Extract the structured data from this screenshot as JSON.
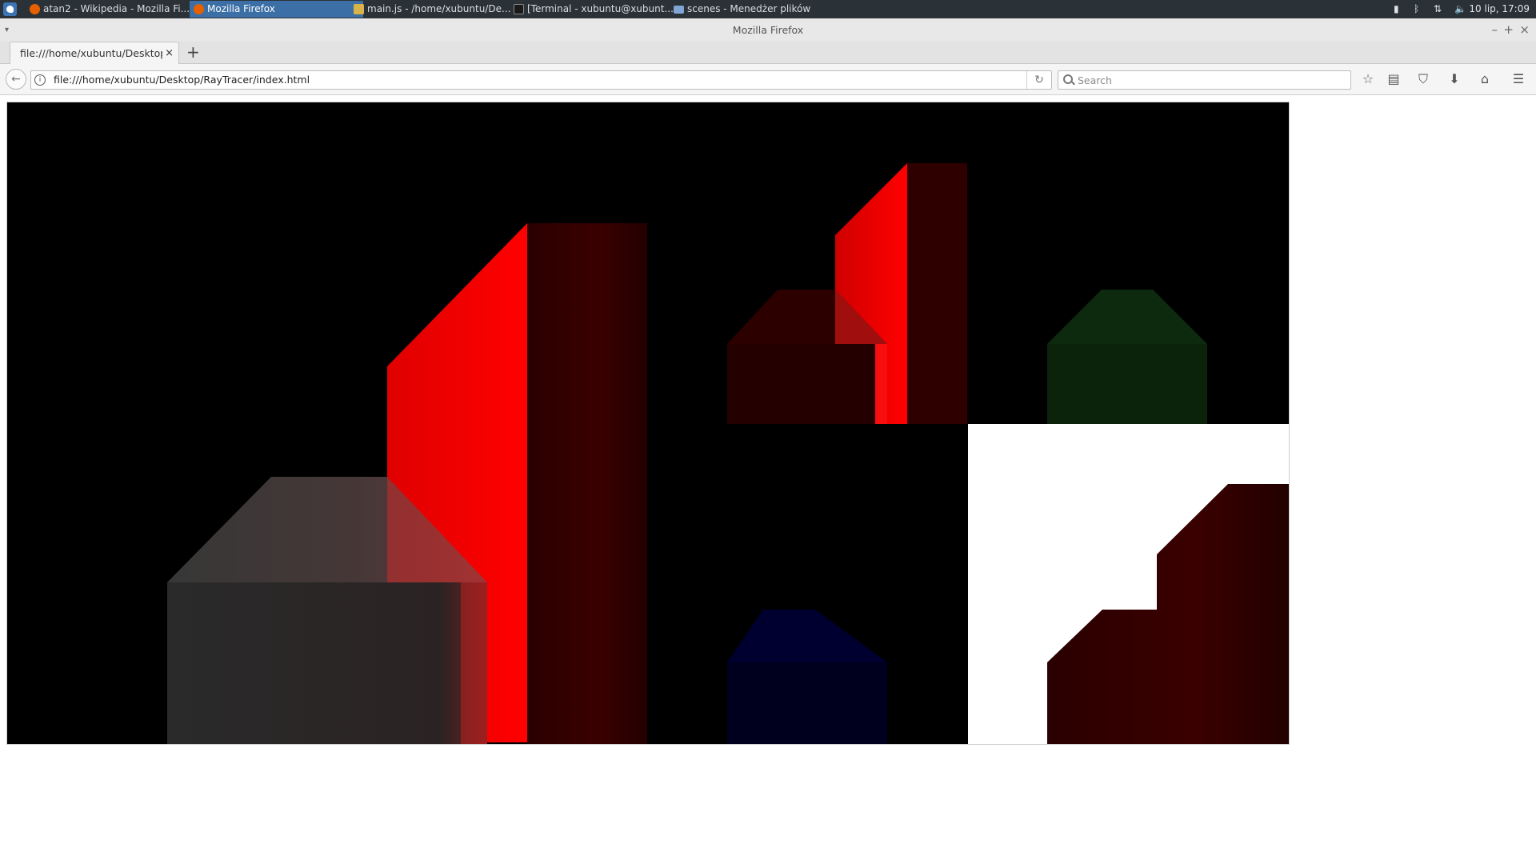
{
  "taskbar": {
    "tasks": [
      {
        "label": "atan2 - Wikipedia - Mozilla Fi...",
        "icon": "firefox-icon",
        "active": false
      },
      {
        "label": "Mozilla Firefox",
        "icon": "firefox-icon",
        "active": true
      },
      {
        "label": "main.js - /home/xubuntu/De...",
        "icon": "text-editor-icon",
        "active": false
      },
      {
        "label": "[Terminal - xubuntu@xubunt...",
        "icon": "terminal-icon",
        "active": false
      },
      {
        "label": "scenes - Menedżer plików",
        "icon": "folder-icon",
        "active": false
      }
    ],
    "clock": "10 lip, 17:09"
  },
  "window": {
    "title": "Mozilla Firefox"
  },
  "tabs": [
    {
      "label": "file:///home/xubuntu/Desktop/R",
      "close": "×"
    }
  ],
  "new_tab_label": "+",
  "navbar": {
    "url": "file:///home/xubuntu/Desktop/RayTracer/index.html",
    "search_placeholder": "Search"
  },
  "colors": {
    "panel_bg": "#2b3237",
    "active_task": "#3b6fa6",
    "canvas_bg": "#000000",
    "red_bright": "#ff0000",
    "red_dark": "#3a0000",
    "green_dark": "#0e2a0e",
    "blue_dark": "#00002a",
    "gray": "#3a3a3a",
    "white_quad": "#ffffff"
  },
  "canvas": {
    "description_icon": "raytracer-canvas"
  }
}
